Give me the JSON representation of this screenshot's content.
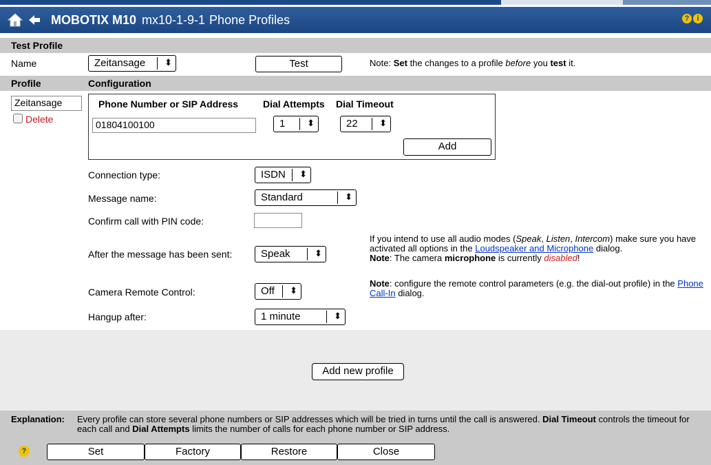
{
  "window": {
    "brand": "MOBOTIX M10",
    "camera_name": "mx10-1-9-1",
    "page_title": "Phone Profiles"
  },
  "test_profile": {
    "section_title": "Test Profile",
    "name_label": "Name",
    "profile_select": "Zeitansage",
    "test_button": "Test",
    "note_prefix": "Note:",
    "note_set": "Set",
    "note_mid": "the changes to a profile",
    "note_before": "before",
    "note_you": "you",
    "note_test": "test",
    "note_end": "it."
  },
  "profile_header": {
    "profile": "Profile",
    "configuration": "Configuration"
  },
  "profile": {
    "name": "Zeitansage",
    "delete_label": "Delete",
    "columns": {
      "number": "Phone Number or SIP Address",
      "attempts": "Dial Attempts",
      "timeout": "Dial Timeout"
    },
    "number_value": "01804100100",
    "attempts_value": "1",
    "timeout_value": "22",
    "add_button": "Add",
    "fields": {
      "connection_type_label": "Connection type:",
      "connection_type_value": "ISDN",
      "message_name_label": "Message name:",
      "message_name_value": "Standard",
      "pin_label": "Confirm call with PIN code:",
      "pin_value": "",
      "after_sent_label": "After the message has been sent:",
      "after_sent_value": "Speak",
      "remote_label": "Camera Remote Control:",
      "remote_value": "Off",
      "hangup_label": "Hangup after:",
      "hangup_value": "1 minute"
    },
    "audio_note": {
      "t1": "If you intend to use all audio modes (",
      "speak": "Speak",
      "c1": ",",
      "listen": "Listen",
      "c2": ",",
      "intercom": "Intercom",
      "t2": ") make sure you have activated all options in the",
      "link": "Loudspeaker and Microphone",
      "t3": "dialog.",
      "note": "Note",
      "t4": ": The camera",
      "mic": "microphone",
      "t5": "is currently",
      "disabled": "disabled",
      "t6": "!"
    },
    "remote_note": {
      "note": "Note",
      "t1": ": configure the remote control parameters (e.g. the dial-out profile) in the",
      "link": "Phone Call-In",
      "t2": "dialog."
    }
  },
  "add_profile_button": "Add new profile",
  "explanation": {
    "label": "Explanation:",
    "t1": "Every profile can store several phone numbers or SIP addresses which will be tried in turns until the call is answered.",
    "b1": "Dial Timeout",
    "t2": "controls the timeout for each call and",
    "b2": "Dial Attempts",
    "t3": "limits the number of calls for each phone number or SIP address."
  },
  "footer_buttons": {
    "set": "Set",
    "factory": "Factory",
    "restore": "Restore",
    "close": "Close"
  },
  "icons": [
    "home-icon",
    "back-arrow-icon",
    "help-icon",
    "info-icon",
    "help-circle-icon",
    "select-arrows-icon"
  ],
  "colors": {
    "title_bar": "#1c4684",
    "header_row": "#c9c9c9",
    "link": "#0033cc",
    "delete": "#d01818"
  }
}
